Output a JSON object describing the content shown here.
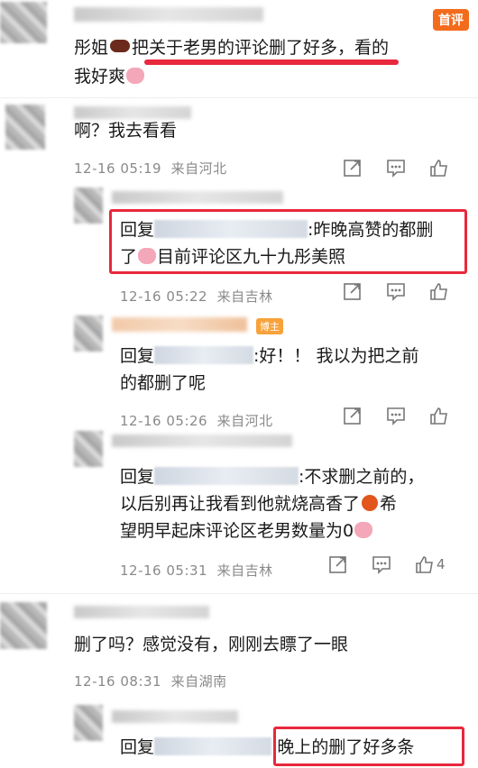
{
  "brand": "首评",
  "comments": [
    {
      "text": "彤姐",
      "text_b": "把关于老男的评论删了好多，看的",
      "text_c": "我好爽"
    },
    {
      "text": "啊？我去看看",
      "time": "12-16 05:19",
      "location": "来自河北"
    },
    {
      "reply_prefix": "回复",
      "text_a": ":昨晚高赞的都删",
      "text_b": "了",
      "text_c": "目前评论区九十九彤美照",
      "time": "12-16 05:22",
      "location": "来自吉林"
    },
    {
      "owner_tag": "博主",
      "reply_prefix": "回复",
      "text_a": ":好！！ 我以为把之前",
      "text_b": "的都删了呢",
      "time": "12-16 05:26",
      "location": "来自河北"
    },
    {
      "reply_prefix": "回复",
      "text_a": ":不求删之前的，",
      "text_b": "以后别再让我看到他就烧高香了",
      "text_c": "希",
      "text_d": "望明早起床评论区老男数量为0",
      "time": "12-16 05:31",
      "location": "来自吉林",
      "likes": "4"
    },
    {
      "text": "删了吗？感觉没有，刚刚去瞟了一眼",
      "time": "12-16 08:31",
      "location": "来自湖南"
    },
    {
      "reply_prefix": "回复",
      "text_a": ":晚上的删了好多条"
    }
  ]
}
